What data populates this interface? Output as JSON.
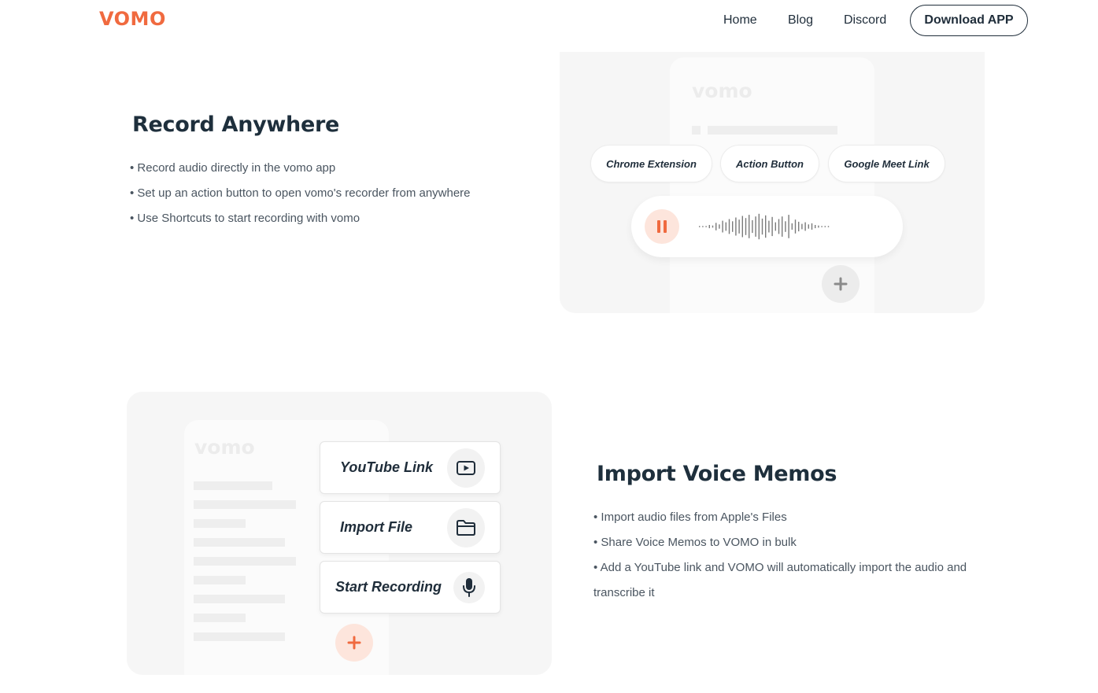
{
  "header": {
    "logo": "VOMO",
    "nav": [
      "Home",
      "Blog",
      "Discord"
    ],
    "download_label": "Download APP"
  },
  "record_section": {
    "title": "Record Anywhere",
    "bullets": [
      "• Record audio directly in the vomo app",
      "• Set up an action button to open vomo's recorder from anywhere",
      "• Use Shortcuts to start recording with vomo"
    ],
    "illustration": {
      "brand": "vomo",
      "pills": [
        "Chrome Extension",
        "Action Button",
        "Google Meet Link"
      ],
      "icons": [
        "pause-icon",
        "waveform-icon",
        "plus-icon"
      ]
    }
  },
  "import_section": {
    "title": "Import Voice Memos",
    "bullets": [
      "• Import audio files from Apple's Files",
      "• Share Voice Memos to VOMO in bulk",
      "• Add a YouTube link and VOMO will automatically import the audio and transcribe it"
    ],
    "illustration": {
      "brand": "vomo",
      "cards": [
        {
          "label": "YouTube Link",
          "icon": "youtube-play-icon"
        },
        {
          "label": "Import File",
          "icon": "folder-icon"
        },
        {
          "label": "Start Recording",
          "icon": "microphone-icon"
        }
      ],
      "add_icon": "plus-icon"
    }
  },
  "colors": {
    "brand": "#f06a3f",
    "heading": "#1e2f3c",
    "body_text": "#4a5560",
    "panel_bg": "#f6f6f6",
    "accent_soft": "#fde5dc"
  }
}
